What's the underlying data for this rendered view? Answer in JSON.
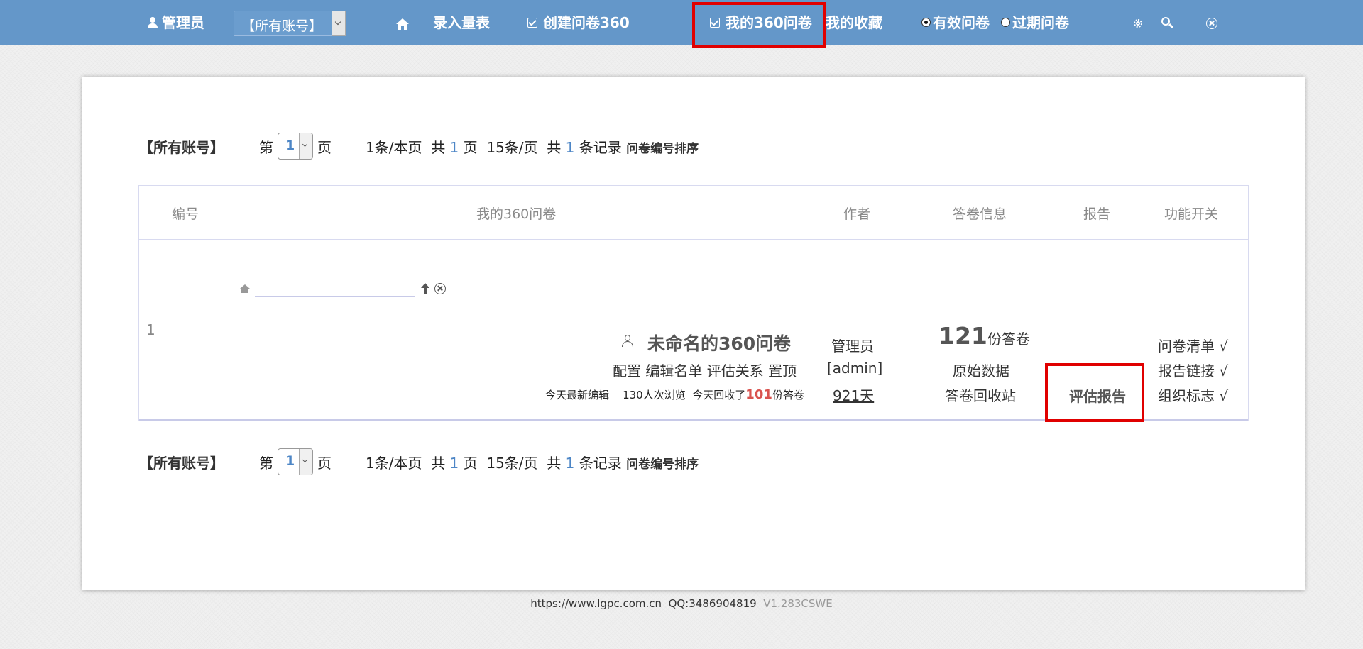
{
  "topbar": {
    "user_label": "管理员",
    "account_select": "【所有账号】",
    "nav_entry": "录入量表",
    "nav_create": "创建问卷360",
    "nav_my360": "我的360问卷",
    "nav_fav": "我的收藏",
    "radio_valid": "有效问卷",
    "radio_expired": "过期问卷",
    "radio_selected": "有效问卷",
    "highlight_color": "#e00000",
    "bar_color": "#6497c9"
  },
  "pager": {
    "account": "【所有账号】",
    "page_prefix": "第",
    "page_value": "1",
    "page_suffix": "页",
    "per_page_a": "1条/本页",
    "total_pages_prefix": "共",
    "total_pages": "1",
    "total_pages_suffix": "页",
    "per_page_b": "15条/页",
    "total_records_prefix": "共",
    "total_records": "1",
    "total_records_suffix": "条记录",
    "sort_link": "问卷编号排序"
  },
  "table": {
    "headers": [
      "编号",
      "我的360问卷",
      "作者",
      "答卷信息",
      "报告",
      "功能开关"
    ],
    "row": {
      "id": "1",
      "title": "未命名的360问卷",
      "actions": "配置 编辑名单 评估关系 置顶",
      "stat_edit": "今天最新编辑",
      "stat_views": "130人次浏览",
      "stat_collect_prefix": "今天回收了",
      "stat_collect_num": "101",
      "stat_collect_suffix": "份答卷",
      "author_name": "管理员",
      "author_account": "[admin]",
      "author_days": "921天",
      "resp_count": "121",
      "resp_unit": "份答卷",
      "raw_data": "原始数据",
      "recycle": "答卷回收站",
      "report": "评估报告",
      "switch_list": "问卷清单 √",
      "switch_link": "报告链接 √",
      "switch_logo": "组织标志 √",
      "collect_color": "#d9534f"
    }
  },
  "footer": {
    "site": "https://www.lgpc.com.cn",
    "qq": "QQ:3486904819",
    "version": "V1.283CSWE"
  }
}
